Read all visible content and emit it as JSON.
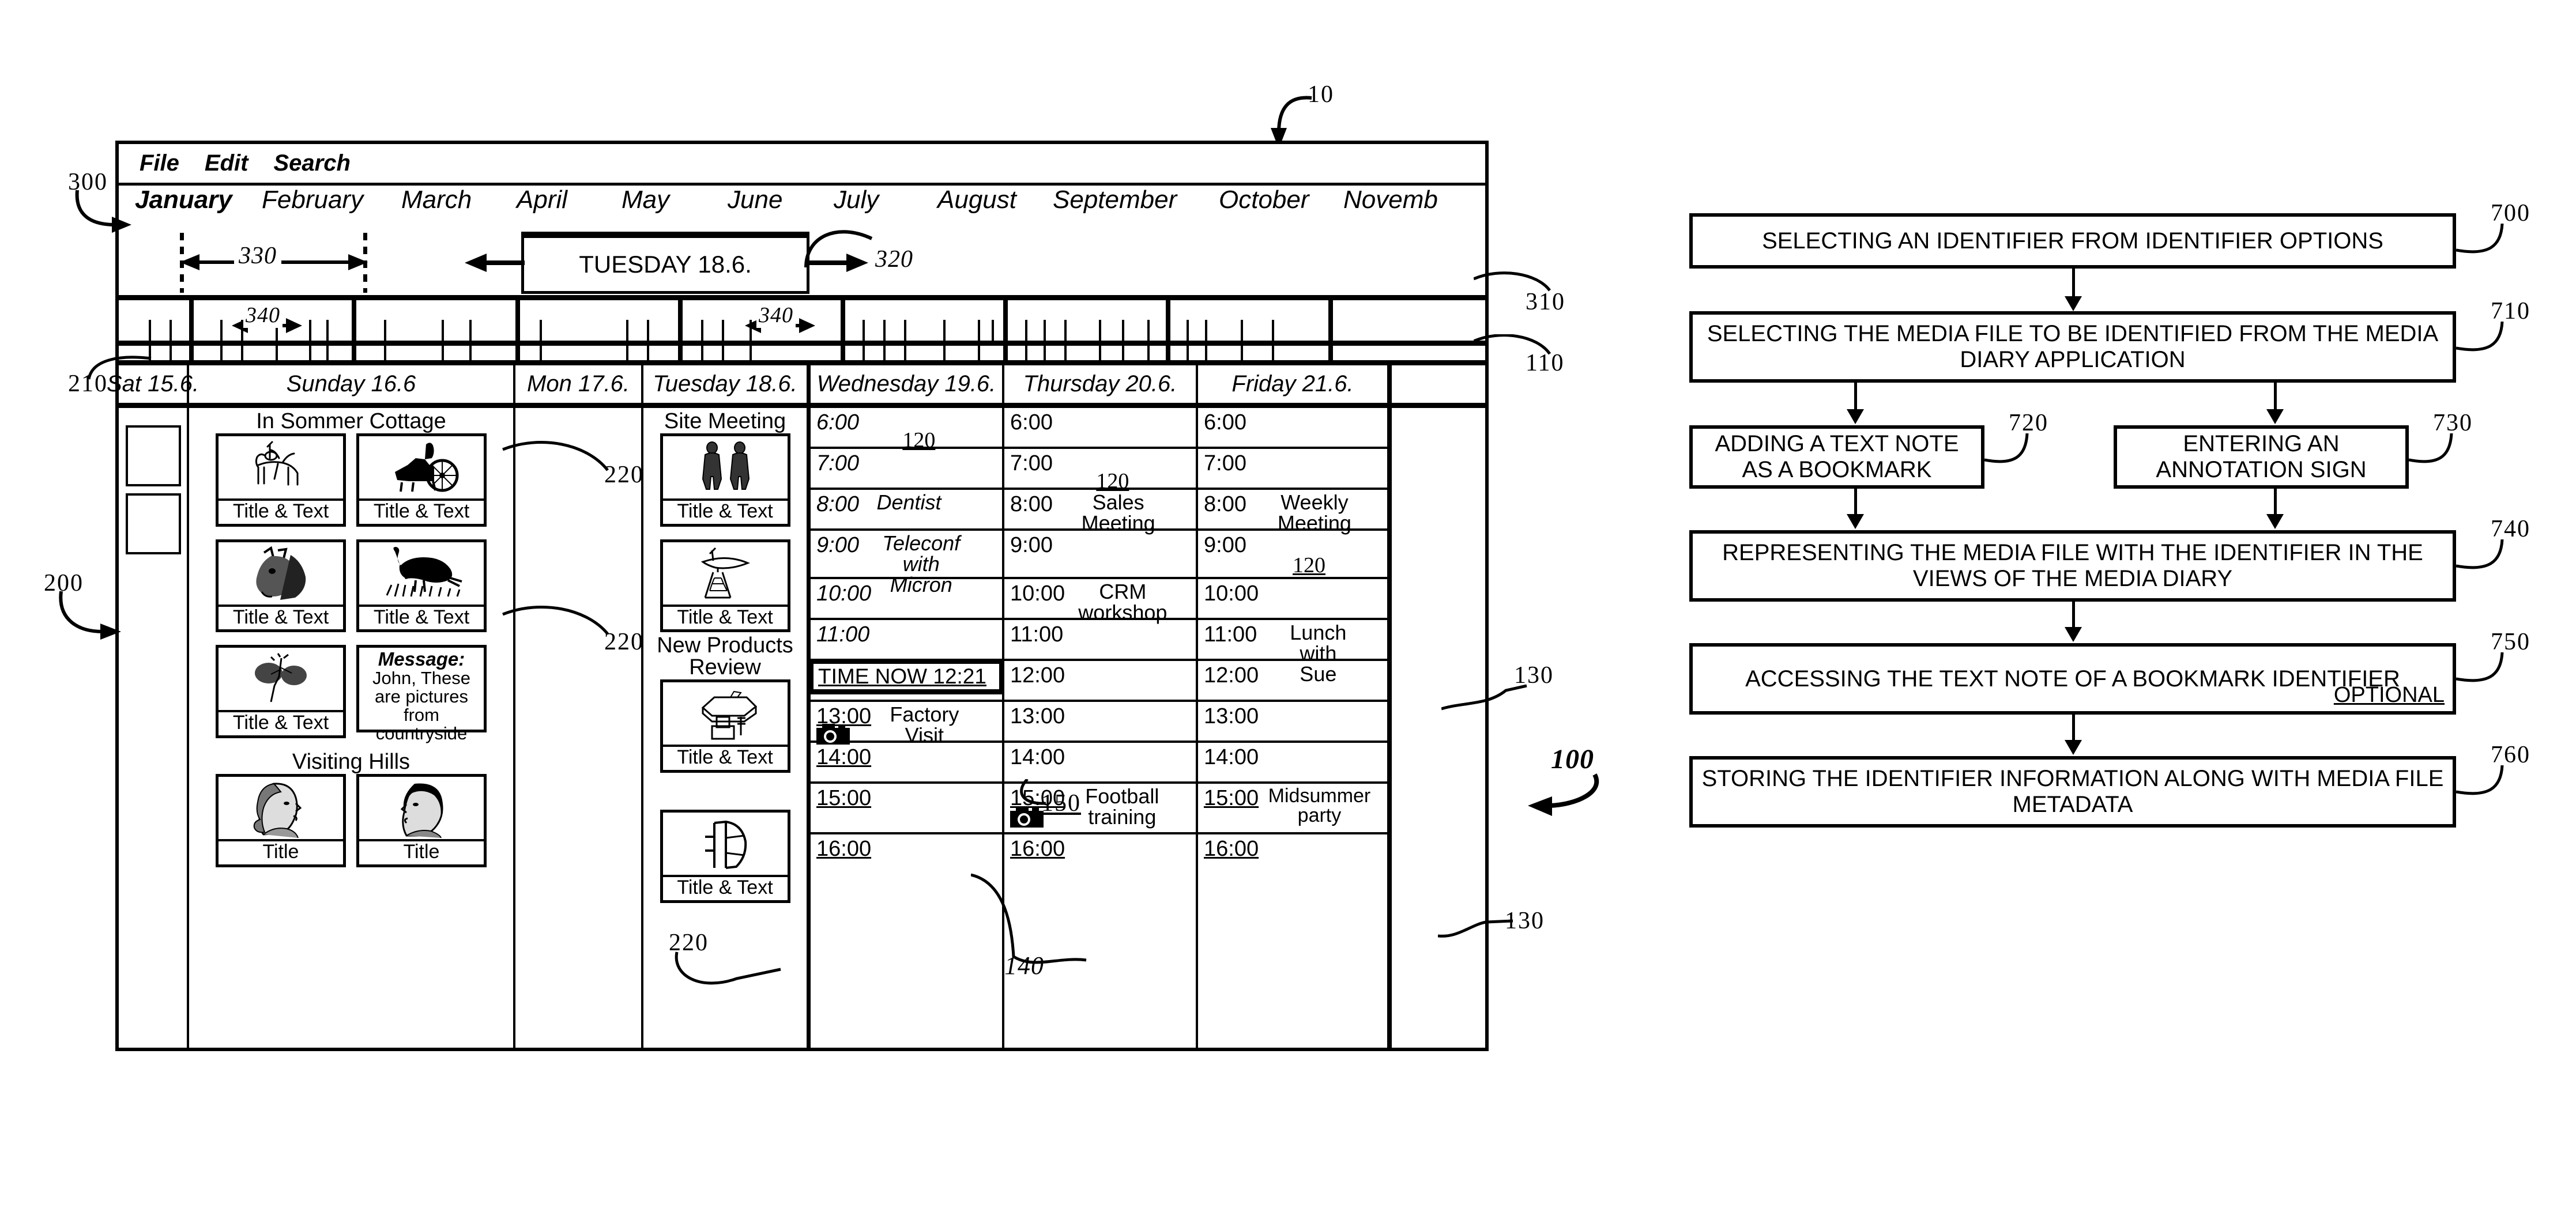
{
  "figure": {
    "ref_main": "10",
    "ref_window": "100",
    "ref_menubar": "300",
    "ref_timeline": "310",
    "ref_dayheader": "110",
    "ref_daycol": "210",
    "ref_content": "200",
    "ref_thumb": "220",
    "ref_event": "130",
    "ref_photoicon": "140",
    "ref_timenow": "150",
    "ref_bookmark": "120",
    "ref_span_month": "330",
    "ref_selected_day": "320",
    "ref_span_day": "340"
  },
  "menubar": {
    "items": [
      "File",
      "Edit",
      "Search"
    ]
  },
  "months": {
    "selected": "January",
    "items": [
      "January",
      "February",
      "March",
      "April",
      "May",
      "June",
      "July",
      "August",
      "September",
      "October",
      "Novemb"
    ]
  },
  "selection": {
    "day_label": "TUESDAY 18.6."
  },
  "day_headers": [
    "Sat 15.6.",
    "Sunday 16.6",
    "Mon 17.6.",
    "Tuesday 18.6.",
    "Wednesday 19.6.",
    "Thursday 20.6.",
    "Friday 21.6."
  ],
  "sunday": {
    "group1_title": "In Sommer Cottage",
    "group2_title": "Visiting Hills",
    "captions": {
      "title_and_text": "Title & Text",
      "title": "Title"
    },
    "message": {
      "head": "Message:",
      "body": "John, These are pictures from countryside"
    }
  },
  "tuesday": {
    "title1": "Site Meeting",
    "title2": "New Products Review",
    "caption": "Title & Text"
  },
  "wednesday": {
    "rows": [
      {
        "time": "6:00",
        "event": "",
        "bookmark": "120",
        "italic": true
      },
      {
        "time": "7:00",
        "event": "",
        "bookmark": "",
        "italic": true
      },
      {
        "time": "8:00",
        "event": "Dentist",
        "bookmark": "",
        "italic": true
      },
      {
        "time": "9:00",
        "event": "Teleconf\nwith Micron",
        "bookmark": "",
        "italic": true
      },
      {
        "time": "10:00",
        "event": "",
        "bookmark": "",
        "italic": true
      },
      {
        "time": "11:00",
        "event": "",
        "bookmark": "",
        "italic": true
      },
      {
        "time": "TIME NOW 12:21",
        "event": "",
        "bookmark": "",
        "now": true
      },
      {
        "time": "13:00",
        "event": "Factory\nVisit",
        "bookmark": "",
        "camera": true
      },
      {
        "time": "14:00",
        "event": "",
        "bookmark": ""
      },
      {
        "time": "15:00",
        "event": "",
        "bookmark": ""
      },
      {
        "time": "16:00",
        "event": "",
        "bookmark": ""
      }
    ]
  },
  "thursday": {
    "rows": [
      {
        "time": "6:00",
        "event": "",
        "bookmark": ""
      },
      {
        "time": "7:00",
        "event": "",
        "bookmark": "120"
      },
      {
        "time": "8:00",
        "event": "Sales\nMeeting",
        "bookmark": ""
      },
      {
        "time": "9:00",
        "event": "",
        "bookmark": ""
      },
      {
        "time": "10:00",
        "event": "CRM\nworkshop",
        "bookmark": ""
      },
      {
        "time": "11:00",
        "event": "",
        "bookmark": ""
      },
      {
        "time": "12:00",
        "event": "",
        "bookmark": ""
      },
      {
        "time": "13:00",
        "event": "",
        "bookmark": ""
      },
      {
        "time": "14:00",
        "event": "",
        "bookmark": ""
      },
      {
        "time": "15:00",
        "event": "Football\ntraining",
        "bookmark": "",
        "camera": true
      },
      {
        "time": "16:00",
        "event": "",
        "bookmark": ""
      }
    ]
  },
  "friday": {
    "rows": [
      {
        "time": "6:00",
        "event": "",
        "bookmark": ""
      },
      {
        "time": "7:00",
        "event": "",
        "bookmark": ""
      },
      {
        "time": "8:00",
        "event": "Weekly\nMeeting",
        "bookmark": ""
      },
      {
        "time": "9:00",
        "event": "",
        "bookmark": "120"
      },
      {
        "time": "10:00",
        "event": "",
        "bookmark": ""
      },
      {
        "time": "11:00",
        "event": "Lunch\nwith Sue",
        "bookmark": ""
      },
      {
        "time": "12:00",
        "event": "",
        "bookmark": ""
      },
      {
        "time": "13:00",
        "event": "",
        "bookmark": ""
      },
      {
        "time": "14:00",
        "event": "",
        "bookmark": ""
      },
      {
        "time": "15:00",
        "event": "Midsummer\nparty",
        "bookmark": ""
      },
      {
        "time": "16:00",
        "event": "",
        "bookmark": ""
      }
    ]
  },
  "flowchart": {
    "steps": [
      {
        "ref": "700",
        "text": "SELECTING AN IDENTIFIER FROM IDENTIFIER OPTIONS"
      },
      {
        "ref": "710",
        "text": "SELECTING THE MEDIA FILE TO BE IDENTIFIED FROM THE MEDIA DIARY APPLICATION"
      },
      {
        "ref": "720",
        "text": "ADDING A TEXT NOTE AS A BOOKMARK"
      },
      {
        "ref": "730",
        "text": "ENTERING AN ANNOTATION SIGN"
      },
      {
        "ref": "740",
        "text": "REPRESENTING THE MEDIA FILE WITH THE IDENTIFIER IN THE VIEWS OF THE MEDIA DIARY"
      },
      {
        "ref": "750",
        "text": "ACCESSING THE TEXT NOTE OF A BOOKMARK IDENTIFIER",
        "badge": "OPTIONAL"
      },
      {
        "ref": "760",
        "text": "STORING THE IDENTIFIER INFORMATION ALONG WITH MEDIA FILE METADATA"
      }
    ]
  }
}
